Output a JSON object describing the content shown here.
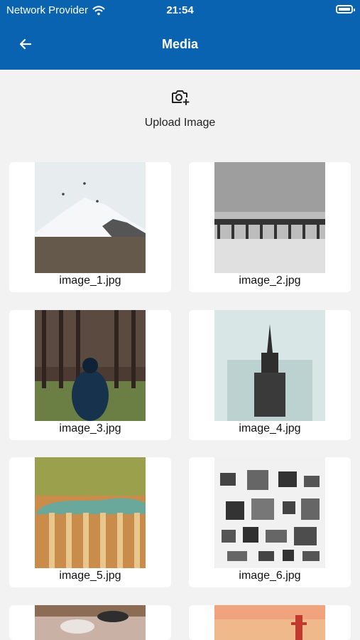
{
  "status": {
    "carrier": "Network Provider",
    "time": "21:54"
  },
  "header": {
    "title": "Media"
  },
  "upload": {
    "label": "Upload Image"
  },
  "images": [
    {
      "filename": "image_1.jpg"
    },
    {
      "filename": "image_2.jpg"
    },
    {
      "filename": "image_3.jpg"
    },
    {
      "filename": "image_4.jpg"
    },
    {
      "filename": "image_5.jpg"
    },
    {
      "filename": "image_6.jpg"
    }
  ],
  "colors": {
    "accent": "#0a63b0",
    "background": "#f2f2f2"
  }
}
